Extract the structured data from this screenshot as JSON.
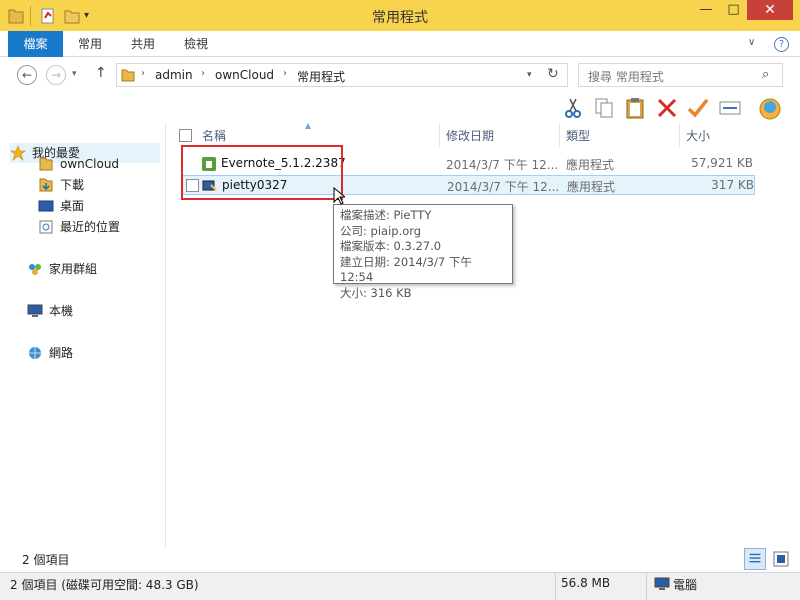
{
  "window": {
    "title": "常用程式",
    "minimize_glyph": "—",
    "maximize_glyph": "□",
    "close_glyph": "✕"
  },
  "ribbon": {
    "tabs": [
      "檔案",
      "常用",
      "共用",
      "檢視"
    ],
    "help_glyph": "?",
    "expand_glyph": "∨"
  },
  "address": {
    "crumbs": [
      "admin",
      "ownCloud",
      "常用程式"
    ],
    "separator": "›"
  },
  "search": {
    "placeholder": "搜尋 常用程式"
  },
  "toolbar": {
    "icons": [
      "cut-icon",
      "copy-icon",
      "paste-icon",
      "delete-icon",
      "check-icon",
      "properties-icon",
      "shell-app-icon"
    ]
  },
  "sidebar": {
    "items": [
      {
        "label": "我的最愛",
        "icon": "star-icon"
      },
      {
        "label": "ownCloud",
        "icon": "folder-icon"
      },
      {
        "label": "下載",
        "icon": "downloads-icon"
      },
      {
        "label": "桌面",
        "icon": "desktop-icon"
      },
      {
        "label": "最近的位置",
        "icon": "recent-places-icon"
      },
      {
        "label": "家用群組",
        "icon": "homegroup-icon"
      },
      {
        "label": "本機",
        "icon": "computer-icon"
      },
      {
        "label": "網路",
        "icon": "network-icon"
      }
    ]
  },
  "filelist": {
    "columns": [
      "名稱",
      "修改日期",
      "類型",
      "大小"
    ],
    "rows": [
      {
        "name": "Evernote_5.1.2.2387",
        "date": "2014/3/7 下午 12...",
        "type": "應用程式",
        "size": "57,921 KB",
        "icon": "evernote-app-icon"
      },
      {
        "name": "pietty0327",
        "date": "2014/3/7 下午 12...",
        "type": "應用程式",
        "size": "317 KB",
        "icon": "pietty-app-icon"
      }
    ]
  },
  "tooltip": {
    "lines": [
      "檔案描述: PieTTY",
      "公司: piaip.org",
      "檔案版本: 0.3.27.0",
      "建立日期: 2014/3/7 下午 12:54",
      "大小: 316 KB"
    ]
  },
  "footer": {
    "item_count": "2 個項目"
  },
  "status": {
    "left": "2 個項目 (磁碟可用空間: 48.3 GB)",
    "size": "56.8 MB",
    "location": "電腦"
  },
  "colors": {
    "titlebar": "#f8d34e",
    "file_tab": "#1979ca",
    "close": "#c7413a",
    "selection": "#e5f3fb",
    "highlight_box": "#e12a2a"
  }
}
